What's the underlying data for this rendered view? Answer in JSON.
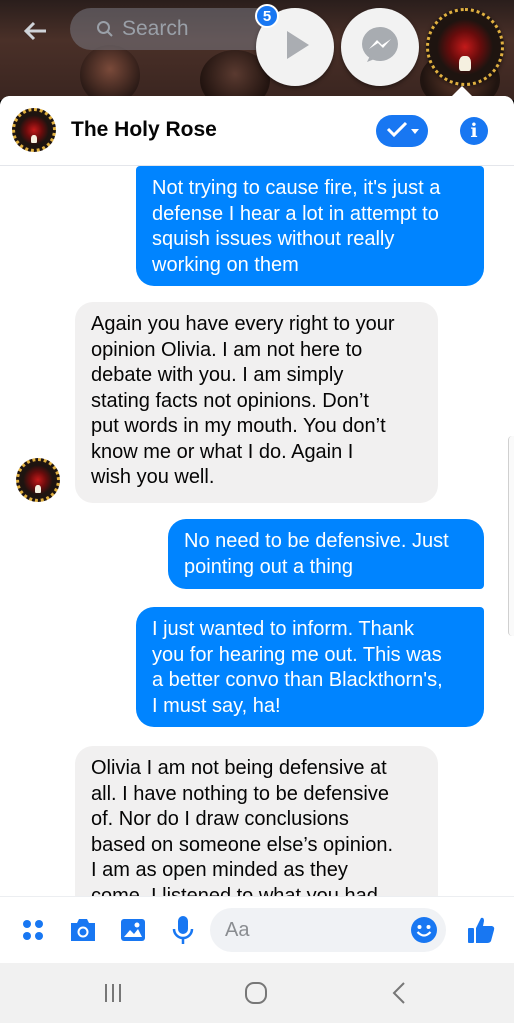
{
  "search": {
    "placeholder": "Search"
  },
  "chat_heads": {
    "badge_count": "5"
  },
  "header": {
    "title": "The Holy Rose"
  },
  "messages": [
    {
      "direction": "out",
      "text": "Not trying to cause fire, it's just a\ndefense I hear a lot in attempt to\nsquish issues without really\nworking on them"
    },
    {
      "direction": "in",
      "text": "Again you have every right to your\nopinion Olivia. I am not here to\ndebate with you. I am simply\nstating  facts not opinions. Don’t\nput words in my mouth. You don’t\nknow me or what I do. Again I\nwish you well."
    },
    {
      "direction": "out",
      "text": "No need to be defensive. Just\npointing out a thing"
    },
    {
      "direction": "out",
      "text": "I just wanted to inform. Thank\nyou for hearing me out. This was\na better convo than Blackthorn's,\nI must say, ha!"
    },
    {
      "direction": "in",
      "text": "Olivia I am not being defensive at\nall. I have nothing to be defensive\nof. Nor do I draw conclusions\nbased on someone else’s opinion.\nI am as open minded as they\ncome. I listened to what you had"
    }
  ],
  "composer": {
    "placeholder": "Aa"
  },
  "colors": {
    "accent": "#1877f2",
    "outgoing_bubble": "#0084ff",
    "incoming_bubble": "#f1f0f0"
  },
  "icons": [
    "back-arrow-icon",
    "search-icon",
    "play-icon",
    "messenger-icon",
    "check-icon",
    "info-icon",
    "apps-icon",
    "camera-icon",
    "image-icon",
    "mic-icon",
    "emoji-icon",
    "thumbs-up-icon",
    "recents-icon",
    "home-icon",
    "back-icon"
  ]
}
